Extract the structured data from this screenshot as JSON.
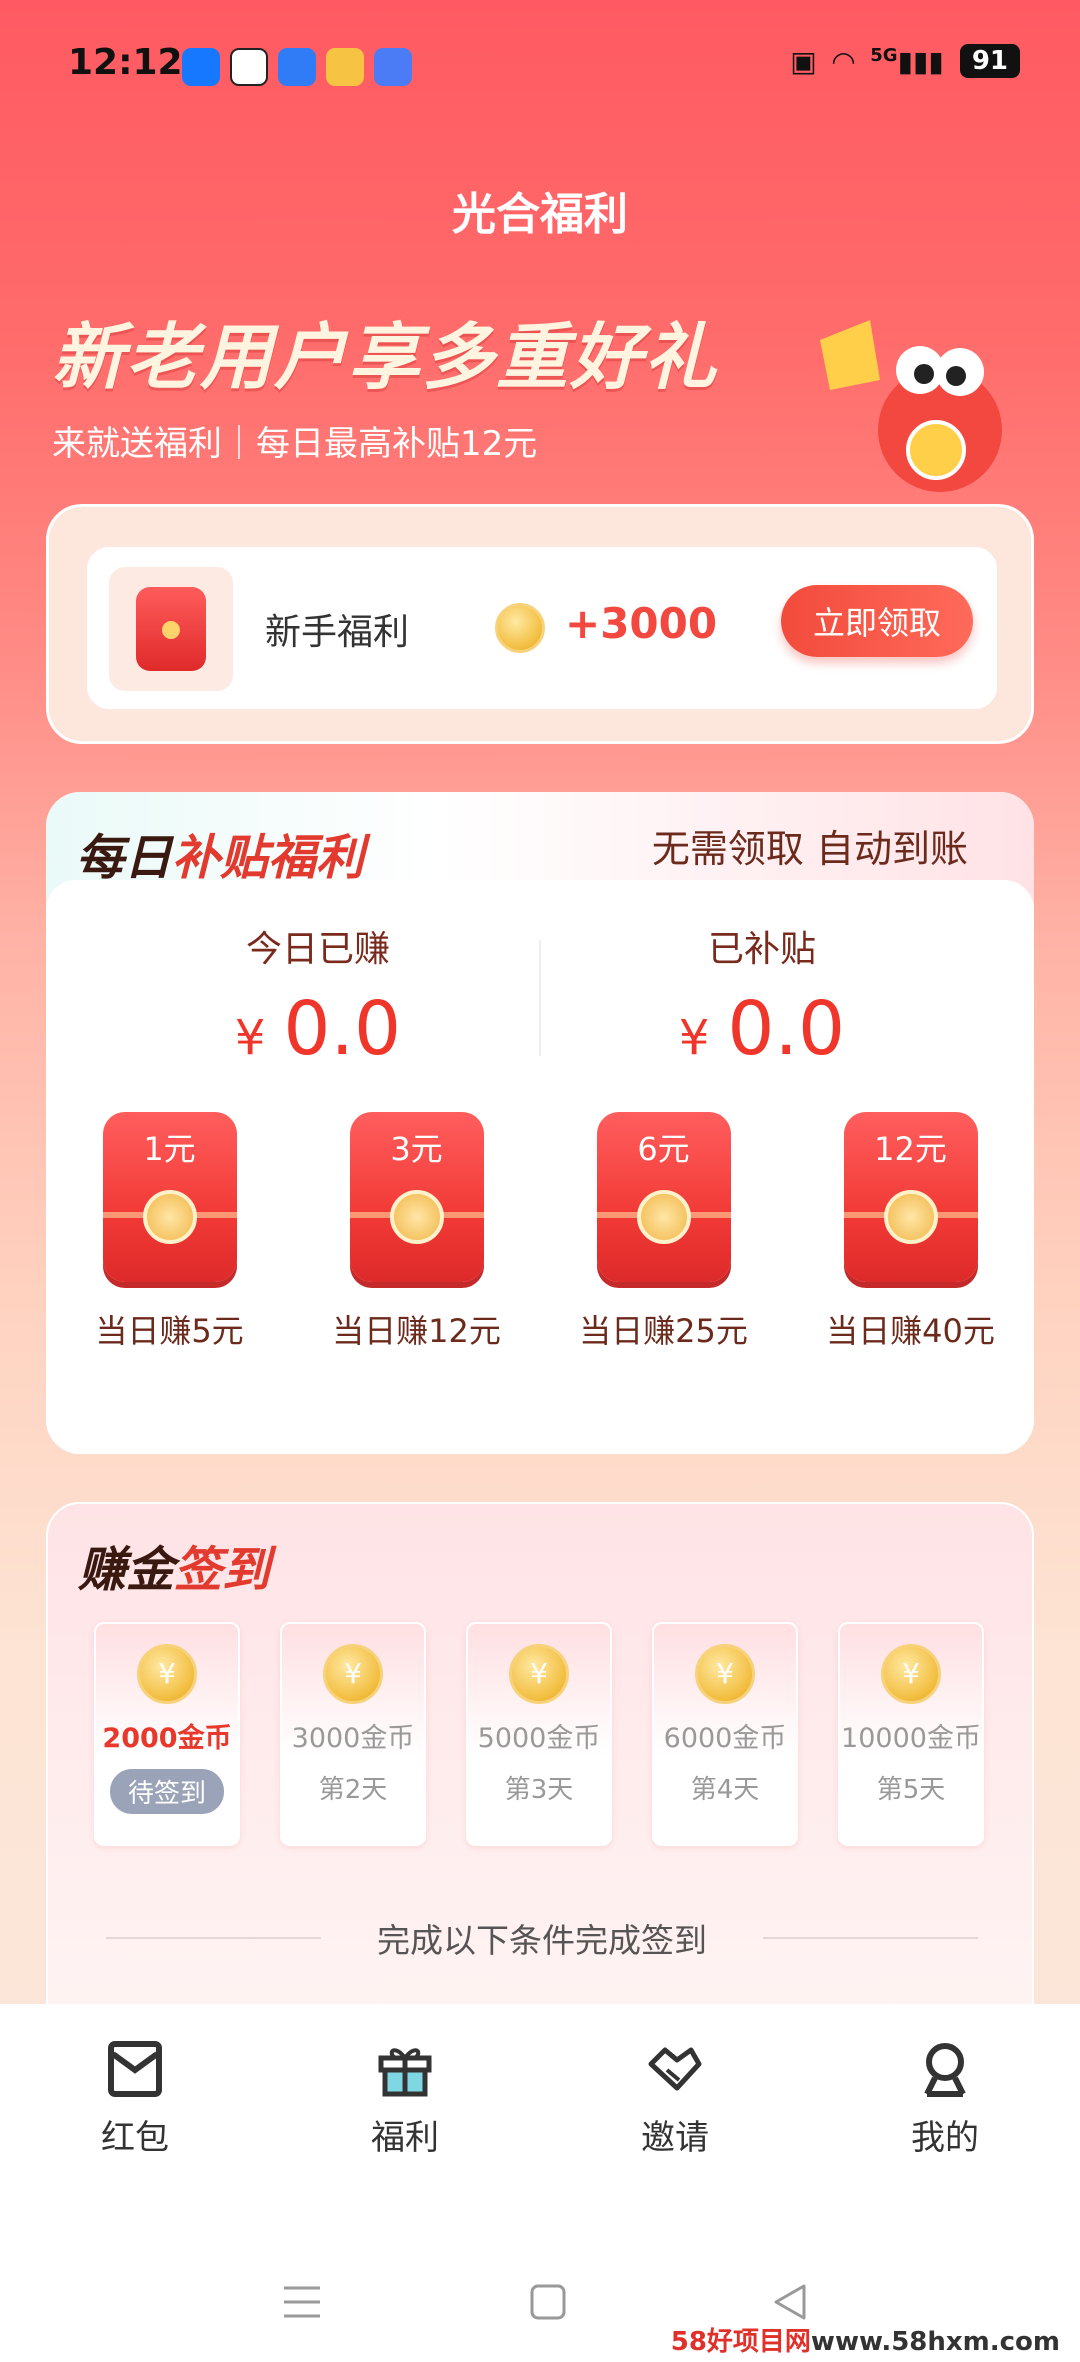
{
  "status_bar": {
    "time": "12:12",
    "network": "5G",
    "battery": "91"
  },
  "header": {
    "title": "光合福利"
  },
  "hero": {
    "title": "新老用户享多重好礼",
    "subtitle": "来就送福利｜每日最高补贴12元"
  },
  "newbie": {
    "label": "新手福利",
    "amount": "+3000",
    "button": "立即领取"
  },
  "daily": {
    "title_a": "每日",
    "title_b": "补贴福利",
    "tag": "无需领取  自动到账",
    "earned_label": "今日已赚",
    "earned_value": "0.0",
    "subsidy_label": "已补贴",
    "subsidy_value": "0.0",
    "currency": "¥",
    "packets": [
      {
        "amount": "1元",
        "caption": "当日赚5元"
      },
      {
        "amount": "3元",
        "caption": "当日赚12元"
      },
      {
        "amount": "6元",
        "caption": "当日赚25元"
      },
      {
        "amount": "12元",
        "caption": "当日赚40元"
      }
    ]
  },
  "signin": {
    "title_a": "赚金",
    "title_b": "签到",
    "coin_symbol": "¥",
    "days": [
      {
        "coins": "2000金币",
        "status": "待签到"
      },
      {
        "coins": "3000金币",
        "status": "第2天"
      },
      {
        "coins": "5000金币",
        "status": "第3天"
      },
      {
        "coins": "6000金币",
        "status": "第4天"
      },
      {
        "coins": "10000金币",
        "status": "第5天"
      }
    ],
    "condition": "完成以下条件完成签到"
  },
  "tabbar": {
    "tabs": [
      {
        "label": "红包",
        "icon": "red-packet-icon"
      },
      {
        "label": "福利",
        "icon": "gift-icon"
      },
      {
        "label": "邀请",
        "icon": "handshake-icon"
      },
      {
        "label": "我的",
        "icon": "profile-icon"
      }
    ]
  },
  "watermark": {
    "a": "58好项目网",
    "b": "www.58hxm.com"
  },
  "colors": {
    "accent": "#f0362a",
    "brand_red": "#ff5a63",
    "text_dark": "#3a1a10"
  }
}
